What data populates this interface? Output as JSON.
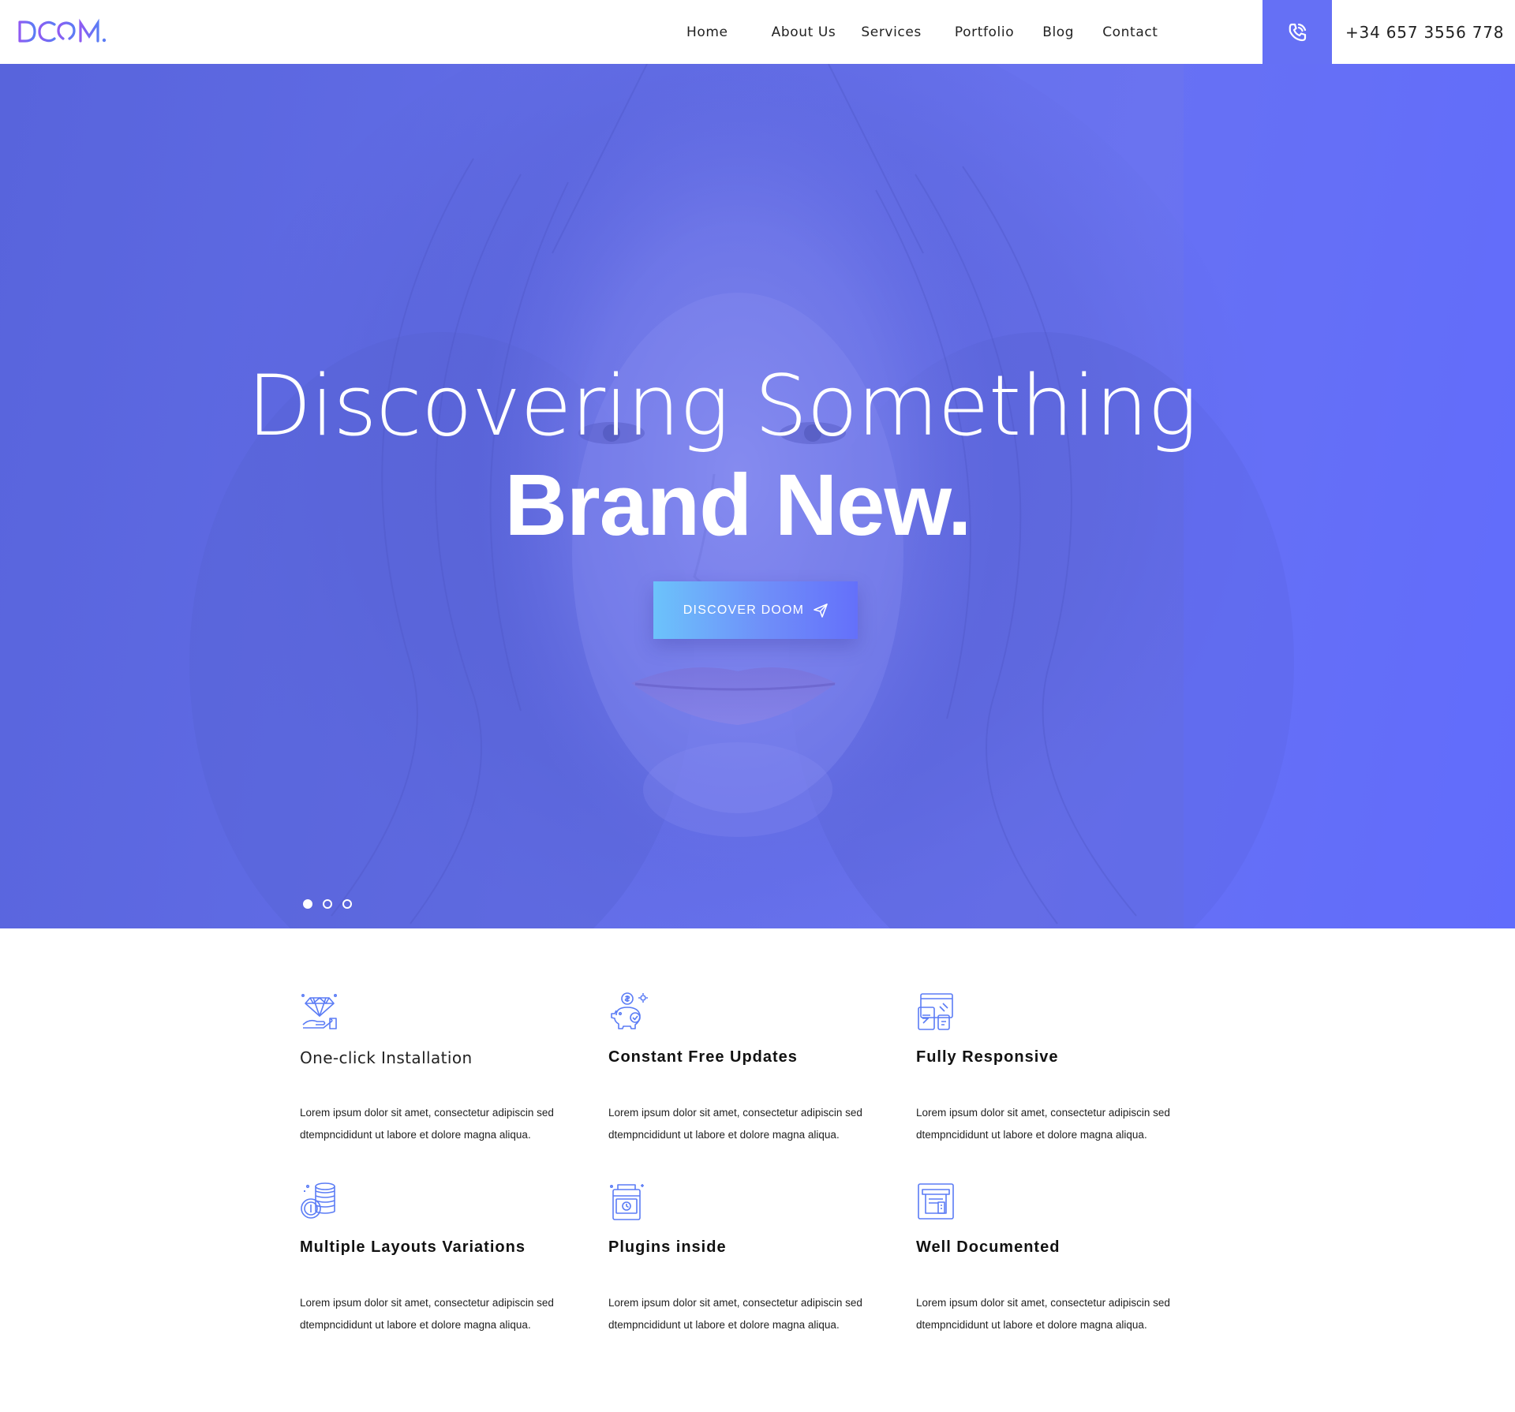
{
  "brand": {
    "logo_text": "DOOM.",
    "accent": "#6570f5"
  },
  "nav": {
    "items": [
      {
        "label": "Home"
      },
      {
        "label": "About Us"
      },
      {
        "label": "Services"
      },
      {
        "label": "Portfolio"
      },
      {
        "label": "Blog"
      },
      {
        "label": "Contact"
      }
    ]
  },
  "contact": {
    "phone_icon": "phone-icon",
    "phone": "+34 657 3556 778"
  },
  "hero": {
    "title_light": "Discovering Something",
    "title_bold": "Brand New.",
    "button_label": "DISCOVER DOOM",
    "button_icon": "paper-plane-icon",
    "slide_count": 3,
    "active_slide": 1,
    "overlay_color": "#636ee8"
  },
  "features": [
    {
      "icon": "diamond-hand-icon",
      "title": "One-click Installation",
      "text": "Lorem ipsum dolor sit amet, consectetur adipiscin sed dtempncididunt ut labore et dolore magna aliqua."
    },
    {
      "icon": "piggy-bank-icon",
      "title": "Constant Free Updates",
      "text": "Lorem ipsum dolor sit amet, consectetur adipiscin sed dtempncididunt ut labore et dolore magna aliqua."
    },
    {
      "icon": "devices-icon",
      "title": "Fully Responsive",
      "text": "Lorem ipsum dolor sit amet, consectetur adipiscin sed dtempncididunt ut labore et dolore magna aliqua."
    },
    {
      "icon": "coins-stack-icon",
      "title": "Multiple Layouts Variations",
      "text": "Lorem ipsum dolor sit amet, consectetur adipiscin sed dtempncididunt ut labore et dolore magna aliqua."
    },
    {
      "icon": "wallet-clock-icon",
      "title": "Plugins inside",
      "text": "Lorem ipsum dolor sit amet, consectetur adipiscin sed dtempncididunt ut labore et dolore magna aliqua."
    },
    {
      "icon": "atm-document-icon",
      "title": "Well Documented",
      "text": "Lorem ipsum dolor sit amet, consectetur adipiscin sed dtempncididunt ut labore et dolore magna aliqua."
    }
  ]
}
